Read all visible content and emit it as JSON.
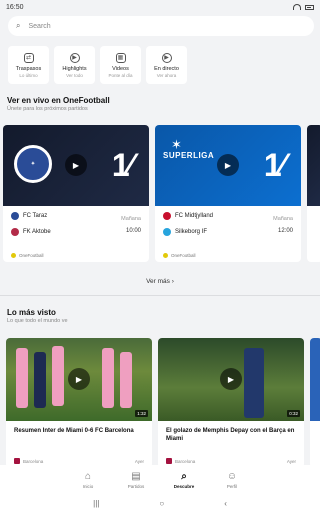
{
  "status": {
    "time": "16:50"
  },
  "search": {
    "placeholder": "Search"
  },
  "quick": [
    {
      "label": "Traspasos",
      "sub": "Lo último",
      "icon": "transfer-icon",
      "glyph": "⇄"
    },
    {
      "label": "Highlights",
      "sub": "Ver todo",
      "icon": "play-icon",
      "glyph": "▶"
    },
    {
      "label": "Videos",
      "sub": "Ponte al día",
      "icon": "calendar-icon",
      "glyph": "▦"
    },
    {
      "label": "En directo",
      "sub": "Ver ahora",
      "icon": "play-icon",
      "glyph": "▶"
    }
  ],
  "live": {
    "title": "Ver en vivo en OneFootball",
    "subtitle": "Únete para los próximos partidos",
    "matches": [
      {
        "home": "FC Taraz",
        "away": "FK Aktobe",
        "day": "Mañana",
        "time": "10:00",
        "provider": "OneFootball",
        "homeColor": "#2a4c97",
        "awayColor": "#b32b48"
      },
      {
        "home": "FC Midtjylland",
        "away": "Silkeborg IF",
        "day": "Mañana",
        "time": "12:00",
        "provider": "OneFootball",
        "homeColor": "#c8102e",
        "awayColor": "#27a4dd",
        "league": "SUPERLIGA"
      }
    ],
    "see_more": "Ver más"
  },
  "videos": {
    "title": "Lo más visto",
    "subtitle": "Lo que todo el mundo ve",
    "items": [
      {
        "title": "Resumen Inter de Miami 0-6 FC Barcelona",
        "duration": "1:32",
        "source": "Barcelona",
        "age": "Ayer"
      },
      {
        "title": "El golazo de Memphis Depay con el Barça en Miami",
        "duration": "0:32",
        "source": "Barcelona",
        "age": "Ayer"
      }
    ]
  },
  "tabs": [
    {
      "label": "Inicio",
      "glyph": "⌂",
      "icon": "home-icon"
    },
    {
      "label": "Partidos",
      "glyph": "▤",
      "icon": "matches-icon"
    },
    {
      "label": "Descubre",
      "glyph": "⌕",
      "icon": "discover-icon",
      "active": true
    },
    {
      "label": "Perfil",
      "glyph": "☺",
      "icon": "profile-icon"
    }
  ],
  "nav": {
    "menu": "|||",
    "home": "○",
    "back": "‹"
  },
  "colors": {
    "accent": "#111111",
    "background": "#f2f3f5",
    "live_blue": "#0a57a8",
    "live_dark": "#131a2c"
  }
}
